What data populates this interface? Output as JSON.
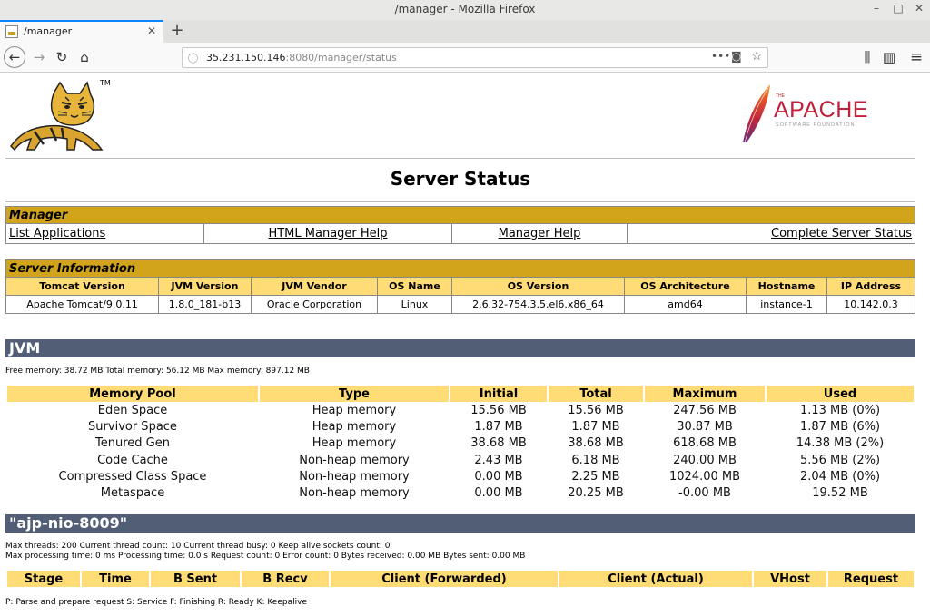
{
  "window": {
    "title": "/manager - Mozilla Firefox",
    "minimize": "–",
    "maximize": "□",
    "close": "✕"
  },
  "tab": {
    "title": "/manager",
    "close": "✕",
    "new_tab": "+"
  },
  "nav": {
    "back": "←",
    "forward": "→",
    "reload": "↻",
    "home": "⌂",
    "url_host": "35.231.150.146",
    "url_rest": ":8080/manager/status",
    "info_icon": "ⓘ",
    "page_actions": "•••",
    "pocket": "◙",
    "bookmark": "☆",
    "library": "⫼",
    "sidebar": "▥",
    "menu": "≡"
  },
  "page": {
    "title": "Server Status",
    "tm": "TM",
    "apache": {
      "the": "THE",
      "name": "APACHE",
      "foundation": "SOFTWARE FOUNDATION"
    }
  },
  "manager": {
    "heading": "Manager",
    "links": [
      "List Applications",
      "HTML Manager Help",
      "Manager Help",
      "Complete Server Status"
    ]
  },
  "server_info": {
    "heading": "Server Information",
    "headers": [
      "Tomcat Version",
      "JVM Version",
      "JVM Vendor",
      "OS Name",
      "OS Version",
      "OS Architecture",
      "Hostname",
      "IP Address"
    ],
    "values": [
      "Apache Tomcat/9.0.11",
      "1.8.0_181-b13",
      "Oracle Corporation",
      "Linux",
      "2.6.32-754.3.5.el6.x86_64",
      "amd64",
      "instance-1",
      "10.142.0.3"
    ]
  },
  "jvm": {
    "heading": "JVM",
    "memory_line": "Free memory: 38.72 MB Total memory: 56.12 MB Max memory: 897.12 MB",
    "headers": [
      "Memory Pool",
      "Type",
      "Initial",
      "Total",
      "Maximum",
      "Used"
    ],
    "rows": [
      [
        "Eden Space",
        "Heap memory",
        "15.56 MB",
        "15.56 MB",
        "247.56 MB",
        "1.13 MB (0%)"
      ],
      [
        "Survivor Space",
        "Heap memory",
        "1.87 MB",
        "1.87 MB",
        "30.87 MB",
        "1.87 MB (6%)"
      ],
      [
        "Tenured Gen",
        "Heap memory",
        "38.68 MB",
        "38.68 MB",
        "618.68 MB",
        "14.38 MB (2%)"
      ],
      [
        "Code Cache",
        "Non-heap memory",
        "2.43 MB",
        "6.18 MB",
        "240.00 MB",
        "5.56 MB (2%)"
      ],
      [
        "Compressed Class Space",
        "Non-heap memory",
        "0.00 MB",
        "2.25 MB",
        "1024.00 MB",
        "2.04 MB (0%)"
      ],
      [
        "Metaspace",
        "Non-heap memory",
        "0.00 MB",
        "20.25 MB",
        "-0.00 MB",
        "19.52 MB"
      ]
    ]
  },
  "connector": {
    "heading": "\"ajp-nio-8009\"",
    "line1": "Max threads: 200 Current thread count: 10 Current thread busy: 0 Keep alive sockets count: 0",
    "line2": "Max processing time: 0 ms Processing time: 0.0 s Request count: 0 Error count: 0 Bytes received: 0.00 MB Bytes sent: 0.00 MB",
    "headers": [
      "Stage",
      "Time",
      "B Sent",
      "B Recv",
      "Client (Forwarded)",
      "Client (Actual)",
      "VHost",
      "Request"
    ],
    "legend": "P: Parse and prepare request S: Service F: Finishing R: Ready K: Keepalive"
  }
}
